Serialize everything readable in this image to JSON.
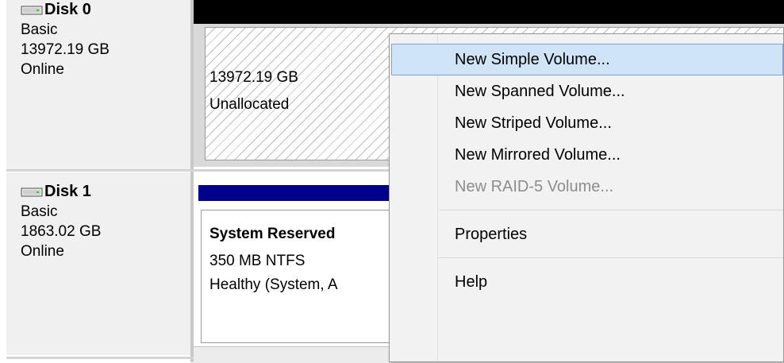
{
  "disks": [
    {
      "name": "Disk 0",
      "type": "Basic",
      "size": "13972.19 GB",
      "status": "Online"
    },
    {
      "name": "Disk 1",
      "type": "Basic",
      "size": "1863.02 GB",
      "status": "Online"
    }
  ],
  "disk0_partition": {
    "size": "13972.19 GB",
    "state": "Unallocated"
  },
  "disk1_partition": {
    "name": "System Reserved",
    "fs": "350 MB NTFS",
    "health": "Healthy (System, A"
  },
  "context_menu": {
    "new_simple": "New Simple Volume...",
    "new_spanned": "New Spanned Volume...",
    "new_striped": "New Striped Volume...",
    "new_mirrored": "New Mirrored Volume...",
    "new_raid5": "New RAID-5 Volume...",
    "properties": "Properties",
    "help": "Help"
  },
  "icons": {
    "disk": "hard-disk-icon"
  },
  "colors": {
    "menu_highlight": "#d0e4f7",
    "disk1_bar": "#00008b",
    "disk0_bar": "#000000"
  }
}
